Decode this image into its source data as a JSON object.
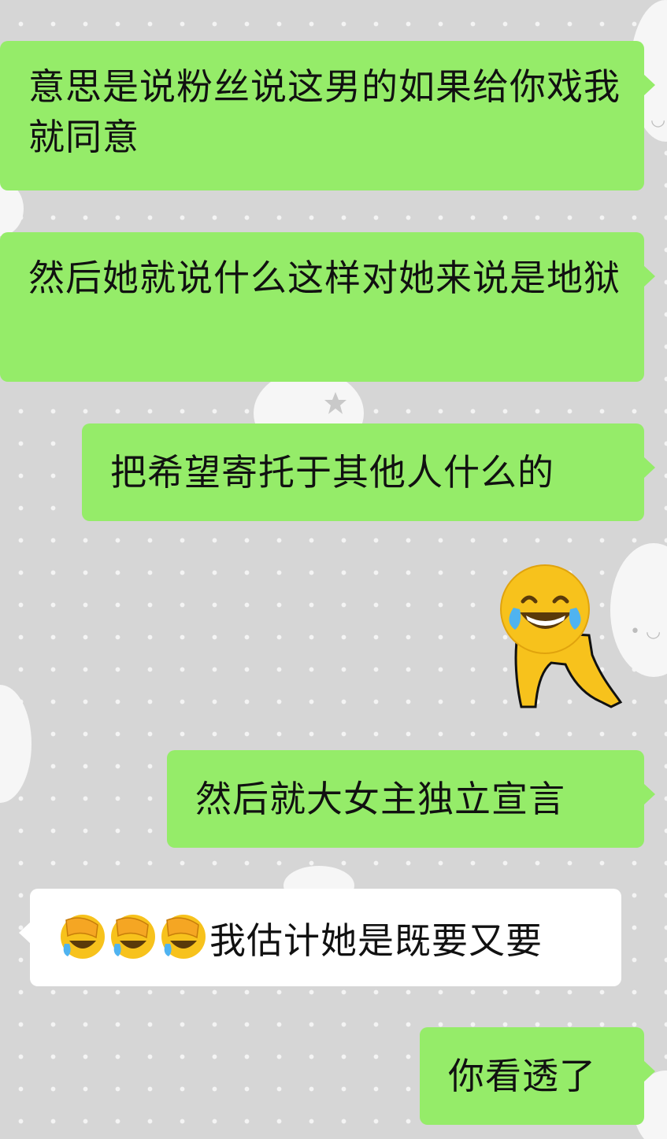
{
  "colors": {
    "outgoing_bubble": "#95ec69",
    "incoming_bubble": "#ffffff",
    "chat_background": "#d6d6d6",
    "text": "#111111"
  },
  "messages": [
    {
      "id": "m1",
      "direction": "outgoing",
      "text": "意思是说粉丝说这男的如果给你戏我就同意"
    },
    {
      "id": "m2",
      "direction": "outgoing",
      "text": "然后她就说什么这样对她来说是地狱"
    },
    {
      "id": "m3",
      "direction": "outgoing",
      "text": "把希望寄托于其他人什么的"
    },
    {
      "id": "m4",
      "direction": "outgoing",
      "type": "sticker",
      "sticker": "laughing-crying-emoji-body-sticker"
    },
    {
      "id": "m5",
      "direction": "outgoing",
      "text": "然后就大女主独立宣言"
    },
    {
      "id": "m6",
      "direction": "incoming",
      "emoji_prefix": [
        "facepalm-laugh-emoji",
        "facepalm-laugh-emoji",
        "facepalm-laugh-emoji"
      ],
      "text": "我估计她是既要又要"
    },
    {
      "id": "m7",
      "direction": "outgoing",
      "text": "你看透了"
    }
  ],
  "background": {
    "pattern": "white-dots",
    "decorations": [
      "cloud-icon",
      "star-icon"
    ]
  }
}
